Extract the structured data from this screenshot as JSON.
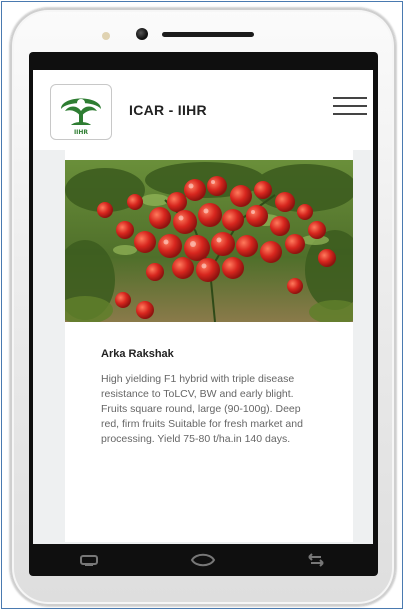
{
  "app": {
    "title": "ICAR - IIHR",
    "logo_text": "IIHR",
    "menu_icon": "hamburger-menu-icon"
  },
  "variety": {
    "name": "Arka Rakshak",
    "description": "High yielding F1 hybrid with triple disease resistance to ToLCV, BW and early blight. Fruits square round, large (90-100g). Deep red, firm fruits Suitable for fresh market and processing. Yield 75-80 t/ha.in 140 days.",
    "image": "tomato-plant-photo"
  },
  "navigation": {
    "icons": [
      "back-icon",
      "home-icon",
      "recent-apps-icon"
    ]
  },
  "colors": {
    "header_bg": "#ffffff",
    "content_bg": "#eef0f1",
    "logo_green": "#2e7d32",
    "tomato_red": "#d7261e",
    "frame_border": "#4a7ab0"
  }
}
